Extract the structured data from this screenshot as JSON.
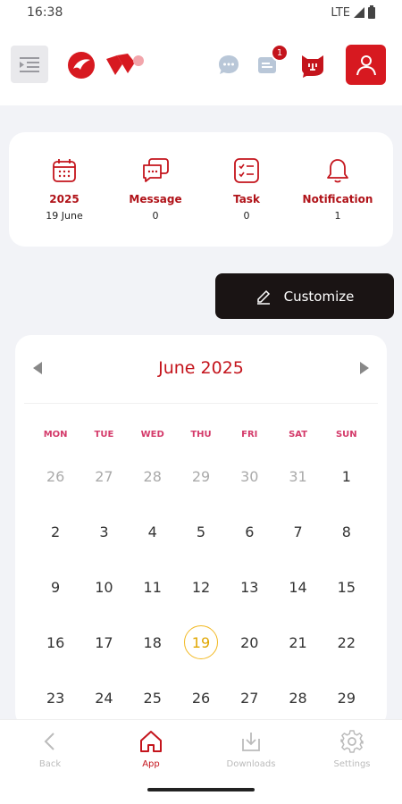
{
  "status_bar": {
    "time": "16:38",
    "network": "LTE"
  },
  "header": {
    "notification_badge": "1",
    "colors": {
      "brand_red": "#d71920"
    }
  },
  "summary": [
    {
      "label": "2025",
      "value": "19 June",
      "icon": "calendar-icon"
    },
    {
      "label": "Message",
      "value": "0",
      "icon": "message-icon"
    },
    {
      "label": "Task",
      "value": "0",
      "icon": "task-icon"
    },
    {
      "label": "Notification",
      "value": "1",
      "icon": "bell-icon"
    }
  ],
  "customize": {
    "label": "Customize"
  },
  "calendar": {
    "title": "June 2025",
    "weekdays": [
      "MON",
      "TUE",
      "WED",
      "THU",
      "FRI",
      "SAT",
      "SUN"
    ],
    "days": [
      {
        "n": "26",
        "muted": true
      },
      {
        "n": "27",
        "muted": true
      },
      {
        "n": "28",
        "muted": true
      },
      {
        "n": "29",
        "muted": true
      },
      {
        "n": "30",
        "muted": true
      },
      {
        "n": "31",
        "muted": true
      },
      {
        "n": "1"
      },
      {
        "n": "2"
      },
      {
        "n": "3"
      },
      {
        "n": "4"
      },
      {
        "n": "5"
      },
      {
        "n": "6"
      },
      {
        "n": "7"
      },
      {
        "n": "8"
      },
      {
        "n": "9"
      },
      {
        "n": "10"
      },
      {
        "n": "11"
      },
      {
        "n": "12"
      },
      {
        "n": "13"
      },
      {
        "n": "14"
      },
      {
        "n": "15"
      },
      {
        "n": "16"
      },
      {
        "n": "17"
      },
      {
        "n": "18"
      },
      {
        "n": "19",
        "today": true
      },
      {
        "n": "20"
      },
      {
        "n": "21"
      },
      {
        "n": "22"
      },
      {
        "n": "23"
      },
      {
        "n": "24"
      },
      {
        "n": "25"
      },
      {
        "n": "26"
      },
      {
        "n": "27"
      },
      {
        "n": "28"
      },
      {
        "n": "29"
      }
    ]
  },
  "nav": [
    {
      "label": "Back",
      "icon": "chevron-left-icon",
      "active": false
    },
    {
      "label": "App",
      "icon": "home-icon",
      "active": true
    },
    {
      "label": "Downloads",
      "icon": "download-icon",
      "active": false
    },
    {
      "label": "Settings",
      "icon": "gear-icon",
      "active": false
    }
  ]
}
